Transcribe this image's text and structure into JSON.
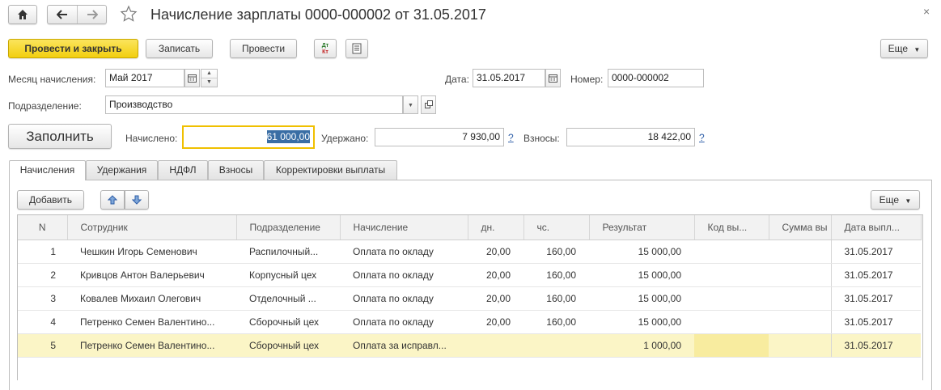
{
  "window": {
    "title": "Начисление зарплаты 0000-000002 от 31.05.2017"
  },
  "toolbar": {
    "post_close": "Провести и закрыть",
    "save": "Записать",
    "post": "Провести",
    "dt_kt": "Дт Кт",
    "more": "Еще"
  },
  "form": {
    "month_label": "Месяц начисления:",
    "month_value": "Май 2017",
    "date_label": "Дата:",
    "date_value": "31.05.2017",
    "number_label": "Номер:",
    "number_value": "0000-000002",
    "dept_label": "Подразделение:",
    "dept_value": "Производство",
    "fill_button": "Заполнить",
    "accrued_label": "Начислено:",
    "accrued_value": "61 000,00",
    "withheld_label": "Удержано:",
    "withheld_value": "7 930,00",
    "contrib_label": "Взносы:",
    "contrib_value": "18 422,00",
    "help": "?"
  },
  "tabs": [
    "Начисления",
    "Удержания",
    "НДФЛ",
    "Взносы",
    "Корректировки выплаты"
  ],
  "table_toolbar": {
    "add": "Добавить",
    "more": "Еще"
  },
  "table": {
    "columns": [
      "N",
      "Сотрудник",
      "Подразделение",
      "Начисление",
      "дн.",
      "чс.",
      "Результат",
      "Код вы...",
      "Сумма вы",
      "Дата выпл..."
    ],
    "rows": [
      [
        "1",
        "Чешкин Игорь Семенович",
        "Распилочный...",
        "Оплата по окладу",
        "20,00",
        "160,00",
        "15 000,00",
        "",
        "",
        "31.05.2017"
      ],
      [
        "2",
        "Кривцов Антон Валерьевич",
        "Корпусный цех",
        "Оплата по окладу",
        "20,00",
        "160,00",
        "15 000,00",
        "",
        "",
        "31.05.2017"
      ],
      [
        "3",
        "Ковалев Михаил Олегович",
        "Отделочный ...",
        "Оплата по окладу",
        "20,00",
        "160,00",
        "15 000,00",
        "",
        "",
        "31.05.2017"
      ],
      [
        "4",
        "Петренко Семен Валентино...",
        "Сборочный цех",
        "Оплата по окладу",
        "20,00",
        "160,00",
        "15 000,00",
        "",
        "",
        "31.05.2017"
      ],
      [
        "5",
        "Петренко Семен Валентино...",
        "Сборочный цех",
        "Оплата за исправл...",
        "",
        "",
        "1 000,00",
        "",
        "",
        "31.05.2017"
      ]
    ]
  },
  "colors": {
    "primary_button": "#f2cf0f",
    "selected_row": "#fbf5c6",
    "focus_border": "#f0c000",
    "selection_text_bg": "#3a6ea5"
  }
}
